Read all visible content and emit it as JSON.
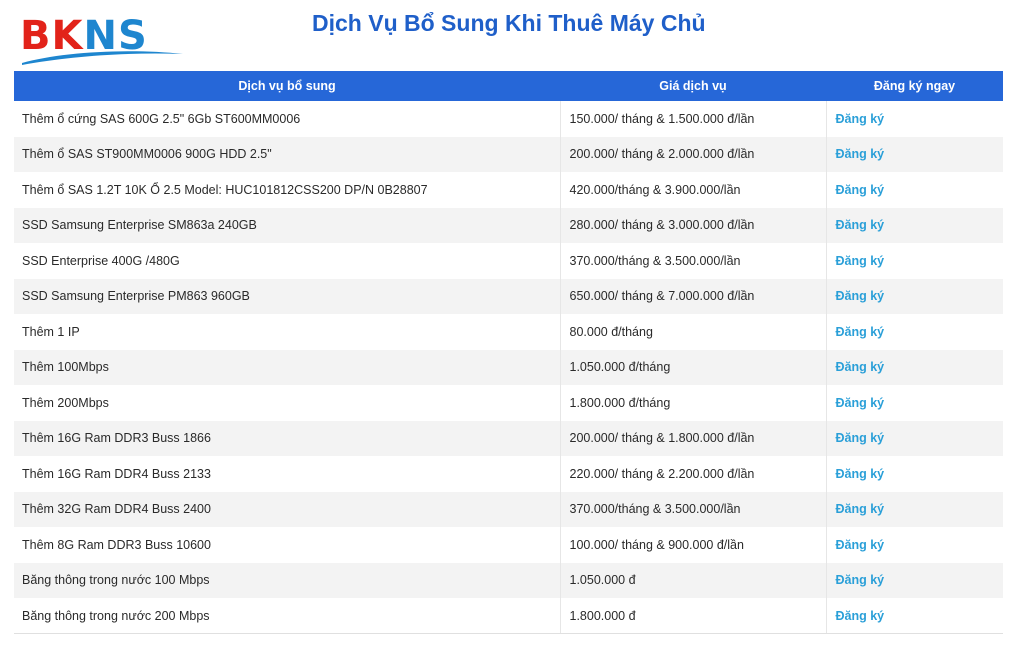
{
  "logo": {
    "part1": "BK",
    "part2": "NS"
  },
  "title": "Dịch Vụ Bổ Sung Khi Thuê Máy Chủ",
  "table": {
    "headers": {
      "service": "Dịch vụ bổ sung",
      "price": "Giá dịch vụ",
      "register": "Đăng ký ngay"
    },
    "rows": [
      {
        "service": "Thêm ổ cứng SAS 600G 2.5\" 6Gb ST600MM0006",
        "price": "150.000/ tháng & 1.500.000 đ/lần",
        "action": "Đăng ký"
      },
      {
        "service": "Thêm ổ SAS ST900MM0006 900G HDD 2.5\"",
        "price": "200.000/ tháng & 2.000.000 đ/lần",
        "action": "Đăng ký"
      },
      {
        "service": "Thêm ổ SAS 1.2T 10K Ổ 2.5 Model: HUC101812CSS200 DP/N 0B28807",
        "price": "420.000/tháng & 3.900.000/lần",
        "action": "Đăng ký"
      },
      {
        "service": "SSD Samsung Enterprise SM863a 240GB",
        "price": "280.000/ tháng & 3.000.000 đ/lần",
        "action": "Đăng ký"
      },
      {
        "service": "SSD Enterprise 400G /480G",
        "price": "370.000/tháng & 3.500.000/lần",
        "action": "Đăng ký"
      },
      {
        "service": "SSD Samsung Enterprise PM863 960GB",
        "price": "650.000/ tháng & 7.000.000 đ/lần",
        "action": "Đăng ký"
      },
      {
        "service": "Thêm 1 IP",
        "price": "80.000 đ/tháng",
        "action": "Đăng ký"
      },
      {
        "service": "Thêm 100Mbps",
        "price": "1.050.000 đ/tháng",
        "action": "Đăng ký"
      },
      {
        "service": "Thêm 200Mbps",
        "price": "1.800.000 đ/tháng",
        "action": "Đăng ký"
      },
      {
        "service": "Thêm 16G Ram DDR3 Buss 1866",
        "price": "200.000/ tháng & 1.800.000 đ/lần",
        "action": "Đăng ký"
      },
      {
        "service": "Thêm 16G Ram DDR4 Buss 2133",
        "price": "220.000/ tháng & 2.200.000 đ/lần",
        "action": "Đăng ký"
      },
      {
        "service": "Thêm 32G Ram DDR4 Buss 2400",
        "price": "370.000/tháng & 3.500.000/lần",
        "action": "Đăng ký"
      },
      {
        "service": "Thêm 8G Ram DDR3 Buss 10600",
        "price": "100.000/ tháng & 900.000 đ/lần",
        "action": "Đăng ký"
      },
      {
        "service": "Băng thông trong nước 100 Mbps",
        "price": "1.050.000 đ",
        "action": "Đăng ký"
      },
      {
        "service": "Băng thông trong nước 200 Mbps",
        "price": "1.800.000 đ",
        "action": "Đăng ký"
      }
    ]
  },
  "colors": {
    "header_bg": "#2667d8",
    "title": "#1f5fc9",
    "link": "#2a9fd8",
    "logo_red": "#e2231a",
    "logo_blue": "#1e86cf"
  }
}
